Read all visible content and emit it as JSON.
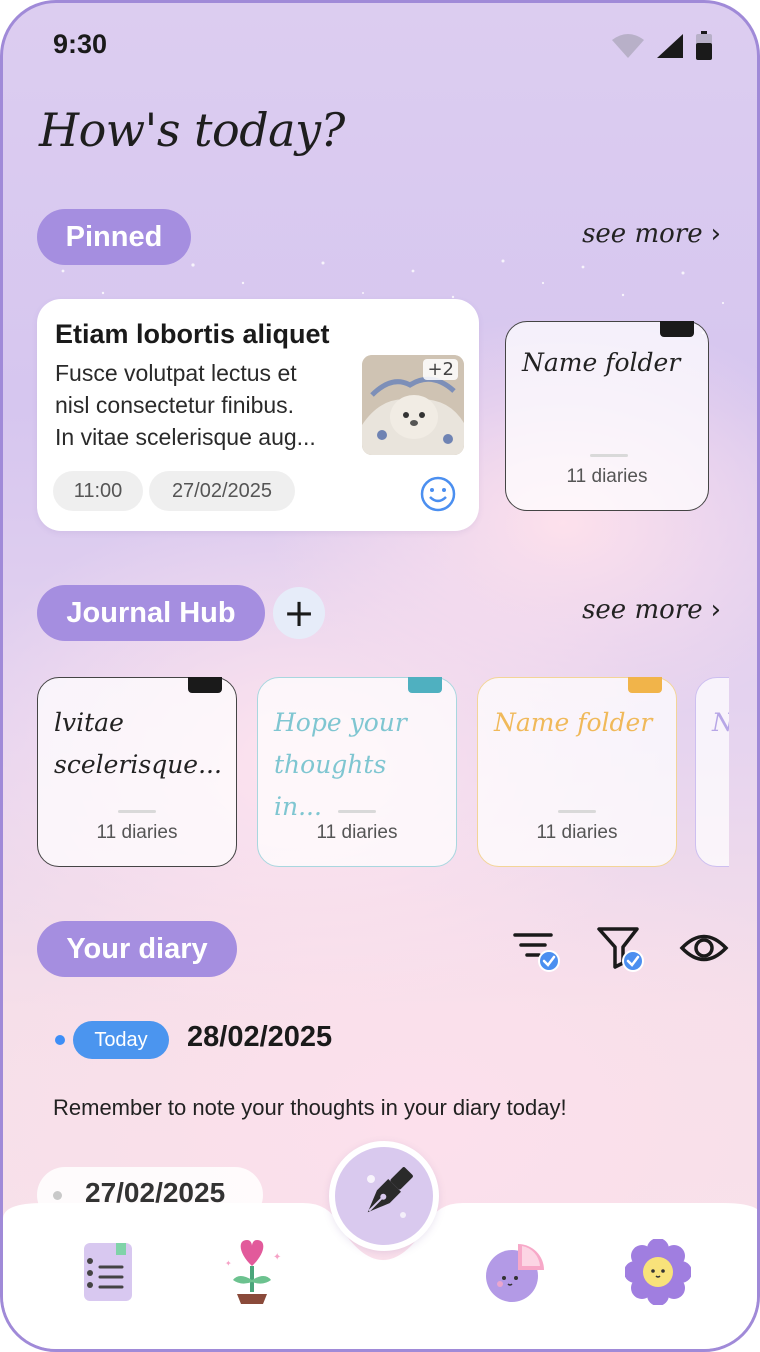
{
  "status_bar": {
    "time": "9:30",
    "icons": [
      "wifi-icon",
      "signal-icon",
      "battery-icon"
    ]
  },
  "page_title": "How's today?",
  "pinned": {
    "label": "Pinned",
    "see_more": "see more",
    "card": {
      "title": "Etiam lobortis aliquet",
      "body_lines": [
        "Fusce volutpat lectus et",
        "nisl consectetur finibus.",
        "In vitae scelerisque aug..."
      ],
      "image_count": "+2",
      "time": "11:00",
      "date": "27/02/2025",
      "mood_icon": "smile-icon"
    },
    "folder": {
      "name": "Name folder",
      "count": "11 diaries",
      "tab_color": "#1a1a1a"
    }
  },
  "journal_hub": {
    "label": "Journal Hub",
    "add_icon": "plus-icon",
    "see_more": "see more",
    "folders": [
      {
        "name_lines": [
          "lvitae",
          "scelerisque..."
        ],
        "count": "11 diaries",
        "tab_color": "#1a1a1a",
        "text_color": "#222222",
        "border_color": "#444444"
      },
      {
        "name_lines": [
          "Hope your",
          "thoughts in..."
        ],
        "count": "11 diaries",
        "tab_color": "#4fb0c0",
        "text_color": "#7fc6d1",
        "border_color": "#a8d7df"
      },
      {
        "name_lines": [
          "Name folder"
        ],
        "count": "11 diaries",
        "tab_color": "#f1b44a",
        "text_color": "#f0b95a",
        "border_color": "#f3d597"
      },
      {
        "name_lines": [
          "N"
        ],
        "count": "",
        "tab_color": "#a58ee0",
        "text_color": "#b7a6e6",
        "border_color": "#cdbff0"
      }
    ]
  },
  "your_diary": {
    "label": "Your diary",
    "tool_icons": [
      "sort-filter-icon",
      "funnel-filter-icon",
      "eye-icon"
    ],
    "today_badge": "Today",
    "today_date": "28/02/2025",
    "reminder": "Remember to note your thoughts in your diary today!",
    "previous_date": "27/02/2025"
  },
  "bottom_nav": {
    "items": [
      "diary-list-icon",
      "heart-plant-icon",
      "pen-nib-icon",
      "pie-chart-icon",
      "flower-icon"
    ]
  },
  "colors": {
    "accent": "#a58ee0",
    "today_badge": "#4b95ef",
    "background_top": "#dccdf0",
    "background_bottom": "#f8e2ea"
  }
}
